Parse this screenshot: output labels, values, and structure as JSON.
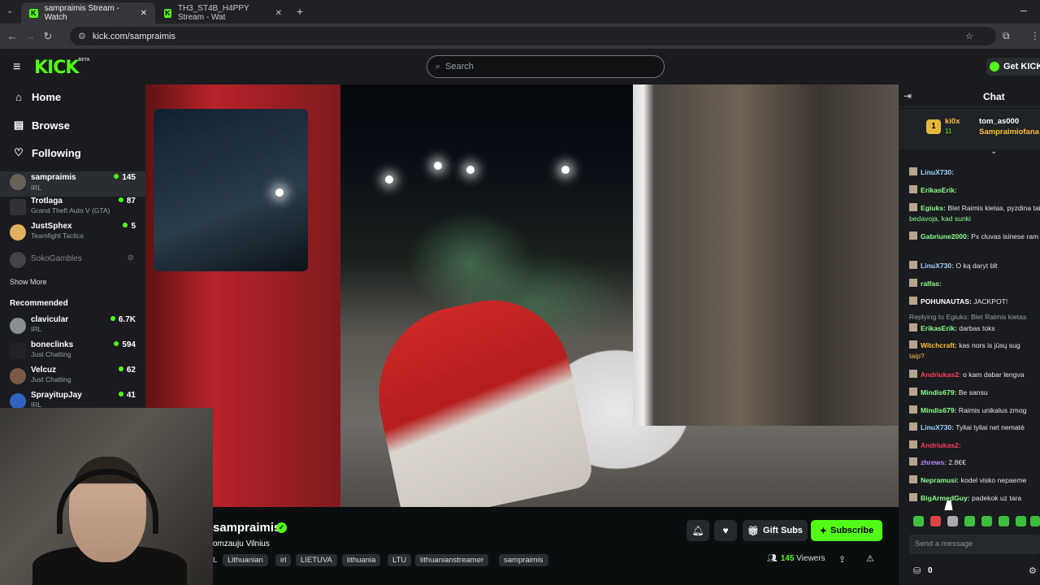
{
  "browser": {
    "tabs": [
      {
        "title": "sampraimis Stream - Watch"
      },
      {
        "title": "TH3_ST4B_H4PPY Stream - Wat"
      }
    ],
    "url": "kick.com/sampraimis"
  },
  "header": {
    "logo": "KICK",
    "logo_beta": "BETA",
    "search_placeholder": "Search",
    "get_kicks": "Get KICKs"
  },
  "sidebar": {
    "nav": [
      {
        "label": "Home",
        "icon": "home-icon"
      },
      {
        "label": "Browse",
        "icon": "browse-icon"
      },
      {
        "label": "Following",
        "icon": "heart-icon"
      }
    ],
    "following": [
      {
        "name": "sampraimis",
        "category": "IRL",
        "viewers": "145"
      },
      {
        "name": "Trotlaga",
        "category": "Grand Theft Auto V (GTA)",
        "viewers": "87"
      },
      {
        "name": "JustSphex",
        "category": "Teamfight Tactics",
        "viewers": "5"
      },
      {
        "name": "SokoGambles",
        "category": "",
        "viewers": ""
      }
    ],
    "show_more": "Show More",
    "recommended_title": "Recommended",
    "recommended": [
      {
        "name": "clavicular",
        "category": "IRL",
        "viewers": "6.7K"
      },
      {
        "name": "boneclinks",
        "category": "Just Chatting",
        "viewers": "594"
      },
      {
        "name": "Velcuz",
        "category": "Just Chatting",
        "viewers": "62"
      },
      {
        "name": "SprayitupJay",
        "category": "IRL",
        "viewers": "41"
      }
    ]
  },
  "stream": {
    "name": "sampraimis",
    "title": "omzauju Vilnius",
    "tags": [
      "Lithuanian",
      "irl",
      "LIETUVA",
      "lithuania",
      "LTU",
      "lithuanianstreamer",
      "sampraimis"
    ],
    "tag_prefix": "L",
    "gift_subs": "Gift Subs",
    "subscribe": "Subscribe",
    "viewers": "145",
    "viewers_label": "Viewers"
  },
  "chat": {
    "title": "Chat",
    "pinned": {
      "user1": "ki0x",
      "user1_count": "11",
      "user2": "tom_as000",
      "user3": "Sampraimiofana"
    },
    "messages": [
      {
        "user": "LinuX730:",
        "text": "",
        "color": "#9fd4ff"
      },
      {
        "user": "ErikasErik:",
        "text": "",
        "color": "#8fff8f"
      },
      {
        "user": "Egiuks:",
        "text": " Blet Raimis kietas, pyzdina tai",
        "color": "#8fff8f"
      },
      {
        "user": "",
        "text": "bedavoja, kad sunki",
        "color": "#8fff8f"
      },
      {
        "user": "Gabriune2000:",
        "text": " Px cluvas isinese ram",
        "color": "#8fff8f"
      },
      {
        "user": "LinuX730:",
        "text": " O ką daryt blt",
        "color": "#9fd4ff"
      },
      {
        "user": "ralfas:",
        "text": "",
        "color": "#8fff8f"
      },
      {
        "user": "POHUNAUTAS:",
        "text": " JACKPOT!",
        "color": "#ffffff"
      },
      {
        "user": "",
        "text": "Replying to Egiuks: Blet Raimis kietas",
        "color": "#9aa0a6"
      },
      {
        "user": "ErikasErik:",
        "text": " darbas toks",
        "color": "#8fff8f"
      },
      {
        "user": "Witchcraft:",
        "text": " kas nors is jūsų sug",
        "color": "#ffbf3f"
      },
      {
        "user": "",
        "text": "taip?",
        "color": "#ffbf3f"
      },
      {
        "user": "Andriukas2:",
        "text": " o kam dabar lengva",
        "color": "#ff3f5f"
      },
      {
        "user": "Mindis679:",
        "text": " Be sansu",
        "color": "#8fff8f"
      },
      {
        "user": "Mindis679:",
        "text": " Raimis unikalus zmog",
        "color": "#8fff8f"
      },
      {
        "user": "LinuX730:",
        "text": " Tyliai tyliai net nematė",
        "color": "#9fd4ff"
      },
      {
        "user": "Andriukas2:",
        "text": "",
        "color": "#ff3f5f"
      },
      {
        "user": "zhrews:",
        "text": " 2.8€€",
        "color": "#b58cff"
      },
      {
        "user": "Nepramusi:",
        "text": " kodel visko nepaeme",
        "color": "#8fff8f"
      },
      {
        "user": "BigArmedGuy:",
        "text": " padekok uz tara",
        "color": "#8fff8f"
      }
    ],
    "input_placeholder": "Send a message",
    "points": "0"
  },
  "colors": {
    "brand": "#53fc18",
    "bg": "#0b0e0f",
    "panel": "#191b1f"
  }
}
